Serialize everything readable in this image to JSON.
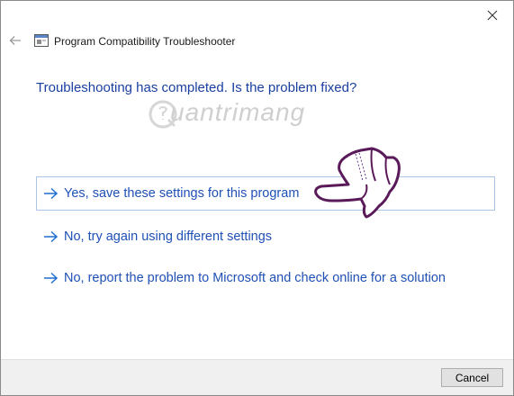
{
  "window": {
    "title": "Program Compatibility Troubleshooter",
    "close_icon": "close-icon",
    "back_icon": "back-arrow-icon",
    "app_icon": "troubleshooter-icon"
  },
  "main": {
    "heading": "Troubleshooting has completed.  Is the problem fixed?",
    "watermark_text": "uantrimang",
    "options": [
      {
        "label": "Yes, save these settings for this program",
        "icon": "arrow-right-icon",
        "highlighted": true
      },
      {
        "label": "No, try again using different settings",
        "icon": "arrow-right-icon",
        "highlighted": false
      },
      {
        "label": "No, report the problem to Microsoft and check online for a solution",
        "icon": "arrow-right-icon",
        "highlighted": false
      }
    ]
  },
  "footer": {
    "cancel_label": "Cancel"
  },
  "colors": {
    "heading": "#1a3fa0",
    "option_text": "#1f50b5",
    "arrow": "#1f6fd0",
    "hand_outline": "#5a1a5a",
    "footer_bg": "#f0f0f0"
  }
}
